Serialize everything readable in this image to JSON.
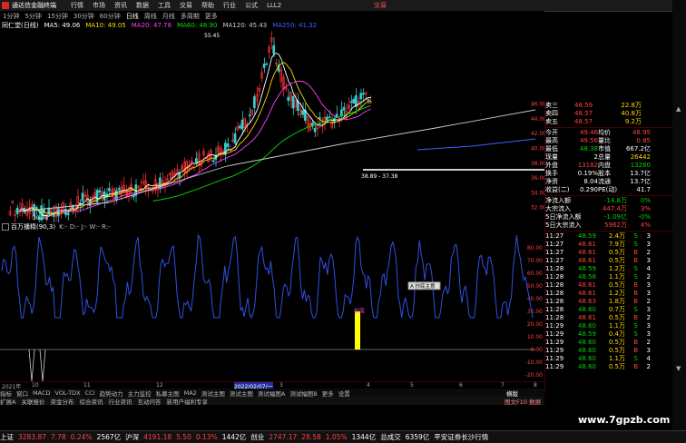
{
  "menu": {
    "app_title": "通达信金融终端",
    "items": [
      "行情",
      "市场",
      "资讯",
      "数据",
      "工具",
      "交易",
      "帮助",
      "行业",
      "公式",
      "LLL2"
    ],
    "right_label": "交易"
  },
  "periods": {
    "items": [
      "1分钟",
      "5分钟",
      "15分钟",
      "30分钟",
      "60分钟",
      "日线",
      "周线",
      "月线",
      "多周期",
      "更多"
    ],
    "active": "日线"
  },
  "ma_line": {
    "label": "同仁堂(日线)",
    "items": [
      {
        "text": "MA5: 49.06",
        "color": "#ffffff"
      },
      {
        "text": "MA10: 49.05",
        "color": "#ffd800"
      },
      {
        "text": "MA20: 47.78",
        "color": "#ff40ff"
      },
      {
        "text": "MA60: 48.90",
        "color": "#00e000"
      },
      {
        "text": "MA120: 45.43",
        "color": "#cccccc"
      },
      {
        "text": "MA250: 41.32",
        "color": "#4060ff"
      }
    ]
  },
  "main_axis": {
    "ticks": [
      "46.00",
      "44.00",
      "42.00",
      "40.00",
      "38.00",
      "36.00",
      "34.00",
      "32.00"
    ]
  },
  "main_annotations": {
    "high": "55.45",
    "low": "30.78",
    "range": "38.89 - 37.38"
  },
  "osc": {
    "title": "百万播精(90,3)",
    "params": "K:- D:- J:- W:- R:-",
    "ticks": [
      "80.00",
      "70.00",
      "60.00",
      "50.00",
      "40.00",
      "30.00",
      "20.00",
      "10.00",
      "0.00",
      "-10.00",
      "-20.00"
    ],
    "tag": "抄底",
    "tooltip": "A 抄底主意"
  },
  "x_axis": {
    "labels": [
      "2021年",
      "10",
      "11",
      "12",
      "2022/02/07/一",
      "3",
      "4",
      "5",
      "6",
      "7",
      "8"
    ]
  },
  "quote": {
    "asks": [
      {
        "label": "卖三",
        "price": "48.59",
        "vol": "22.8万"
      },
      {
        "label": "卖四",
        "price": "48.57",
        "vol": "40.8万"
      },
      {
        "label": "卖五",
        "price": "48.57",
        "vol": "9.2万"
      }
    ],
    "stats": [
      {
        "l1": "今开",
        "v1": "49.46",
        "l2": "均价",
        "v2": "48.95"
      },
      {
        "l1": "最高",
        "v1": "49.56",
        "l2": "量比",
        "v2": "0.85"
      },
      {
        "l1": "最低",
        "v1": "48.38",
        "l2": "市值",
        "v2": "667.2亿"
      },
      {
        "l1": "现量",
        "v1": "2",
        "l2": "总量",
        "v2": "26442"
      },
      {
        "l1": "外盘",
        "v1": "13182",
        "l2": "内盘",
        "v2": "13260"
      },
      {
        "l1": "换手",
        "v1": "0.19%",
        "l2": "股本",
        "v2": "13.7亿"
      },
      {
        "l1": "净资",
        "v1": "8.04",
        "l2": "流通",
        "v2": "13.7亿"
      },
      {
        "l1": "收益(二)",
        "v1": "0.290",
        "l2": "PE(动)",
        "v2": "41.7"
      }
    ],
    "flows": [
      {
        "label": "净流入额",
        "value": "-14.8万",
        "pct": "0%"
      },
      {
        "label": "大宗流入",
        "value": "447.4万",
        "pct": "3%"
      },
      {
        "label": "5日净流入额",
        "value": "-1.09亿",
        "pct": "-0%"
      },
      {
        "label": "5日大宗流入",
        "value": "5962万",
        "pct": "4%"
      }
    ],
    "ticks": [
      {
        "time": "11:27",
        "price": "48.59",
        "vol": "2.4万",
        "dir": "S",
        "n": "3"
      },
      {
        "time": "11:27",
        "price": "48.61",
        "vol": "7.9万",
        "dir": "S",
        "n": "3"
      },
      {
        "time": "11:27",
        "price": "48.61",
        "vol": "0.5万",
        "dir": "B",
        "n": "2"
      },
      {
        "time": "11:27",
        "price": "48.61",
        "vol": "0.5万",
        "dir": "B",
        "n": "3"
      },
      {
        "time": "11:28",
        "price": "48.59",
        "vol": "1.2万",
        "dir": "S",
        "n": "4"
      },
      {
        "time": "11:28",
        "price": "48.58",
        "vol": "1.1万",
        "dir": "S",
        "n": "2"
      },
      {
        "time": "11:28",
        "price": "48.61",
        "vol": "0.5万",
        "dir": "B",
        "n": "3"
      },
      {
        "time": "11:28",
        "price": "48.61",
        "vol": "1.2万",
        "dir": "B",
        "n": "3"
      },
      {
        "time": "11:28",
        "price": "48.63",
        "vol": "1.8万",
        "dir": "B",
        "n": "2"
      },
      {
        "time": "11:28",
        "price": "48.60",
        "vol": "0.7万",
        "dir": "S",
        "n": "3"
      },
      {
        "time": "11:28",
        "price": "48.61",
        "vol": "0.5万",
        "dir": "B",
        "n": "2"
      },
      {
        "time": "11:29",
        "price": "48.60",
        "vol": "1.1万",
        "dir": "S",
        "n": "3"
      },
      {
        "time": "11:29",
        "price": "48.59",
        "vol": "0.4万",
        "dir": "S",
        "n": "3"
      },
      {
        "time": "11:29",
        "price": "48.60",
        "vol": "0.5万",
        "dir": "B",
        "n": "2"
      },
      {
        "time": "11:29",
        "price": "48.60",
        "vol": "0.5万",
        "dir": "B",
        "n": "3"
      },
      {
        "time": "11:29",
        "price": "48.60",
        "vol": "1.1万",
        "dir": "S",
        "n": "4"
      },
      {
        "time": "11:29",
        "price": "48.60",
        "vol": "0.5万",
        "dir": "B",
        "n": "2"
      }
    ]
  },
  "tabs": {
    "row1": [
      "指标",
      "窗口",
      "MACD",
      "VOL-TDX",
      "CCI",
      "趋势动力",
      "主力监控",
      "私募主图",
      "MA2",
      "测试主图",
      "测试主图",
      "测试幅图A",
      "测试幅图B",
      "更多",
      "设置"
    ],
    "row2": [
      "扩展A",
      "关联报价",
      "资金分布",
      "综合资讯",
      "行业资讯",
      "互动问答",
      "新用户福利专享"
    ],
    "right": "横版",
    "right2": "图文F10 数据"
  },
  "statusbar": {
    "items": [
      {
        "text": "上证",
        "color": "#ffffff"
      },
      {
        "text": "3283.87",
        "color": "#ff4040"
      },
      {
        "text": "7.78",
        "color": "#ff4040"
      },
      {
        "text": "0.24%",
        "color": "#ff4040"
      },
      {
        "text": "2567亿",
        "color": "#ffffff"
      },
      {
        "text": "沪深",
        "color": "#ffffff"
      },
      {
        "text": "4191.18",
        "color": "#ff4040"
      },
      {
        "text": "5.50",
        "color": "#ff4040"
      },
      {
        "text": "0.13%",
        "color": "#ff4040"
      },
      {
        "text": "1442亿",
        "color": "#ffffff"
      },
      {
        "text": "创业",
        "color": "#ffffff"
      },
      {
        "text": "2747.17",
        "color": "#ff4040"
      },
      {
        "text": "28.58",
        "color": "#ff4040"
      },
      {
        "text": "1.05%",
        "color": "#ff4040"
      },
      {
        "text": "1344亿",
        "color": "#ffffff"
      },
      {
        "text": "总成交",
        "color": "#ffffff"
      },
      {
        "text": "6359亿",
        "color": "#ffffff"
      },
      {
        "text": "平安证券长沙行情",
        "color": "#ffffff"
      }
    ]
  },
  "watermark": "www.7gpzb.com"
}
